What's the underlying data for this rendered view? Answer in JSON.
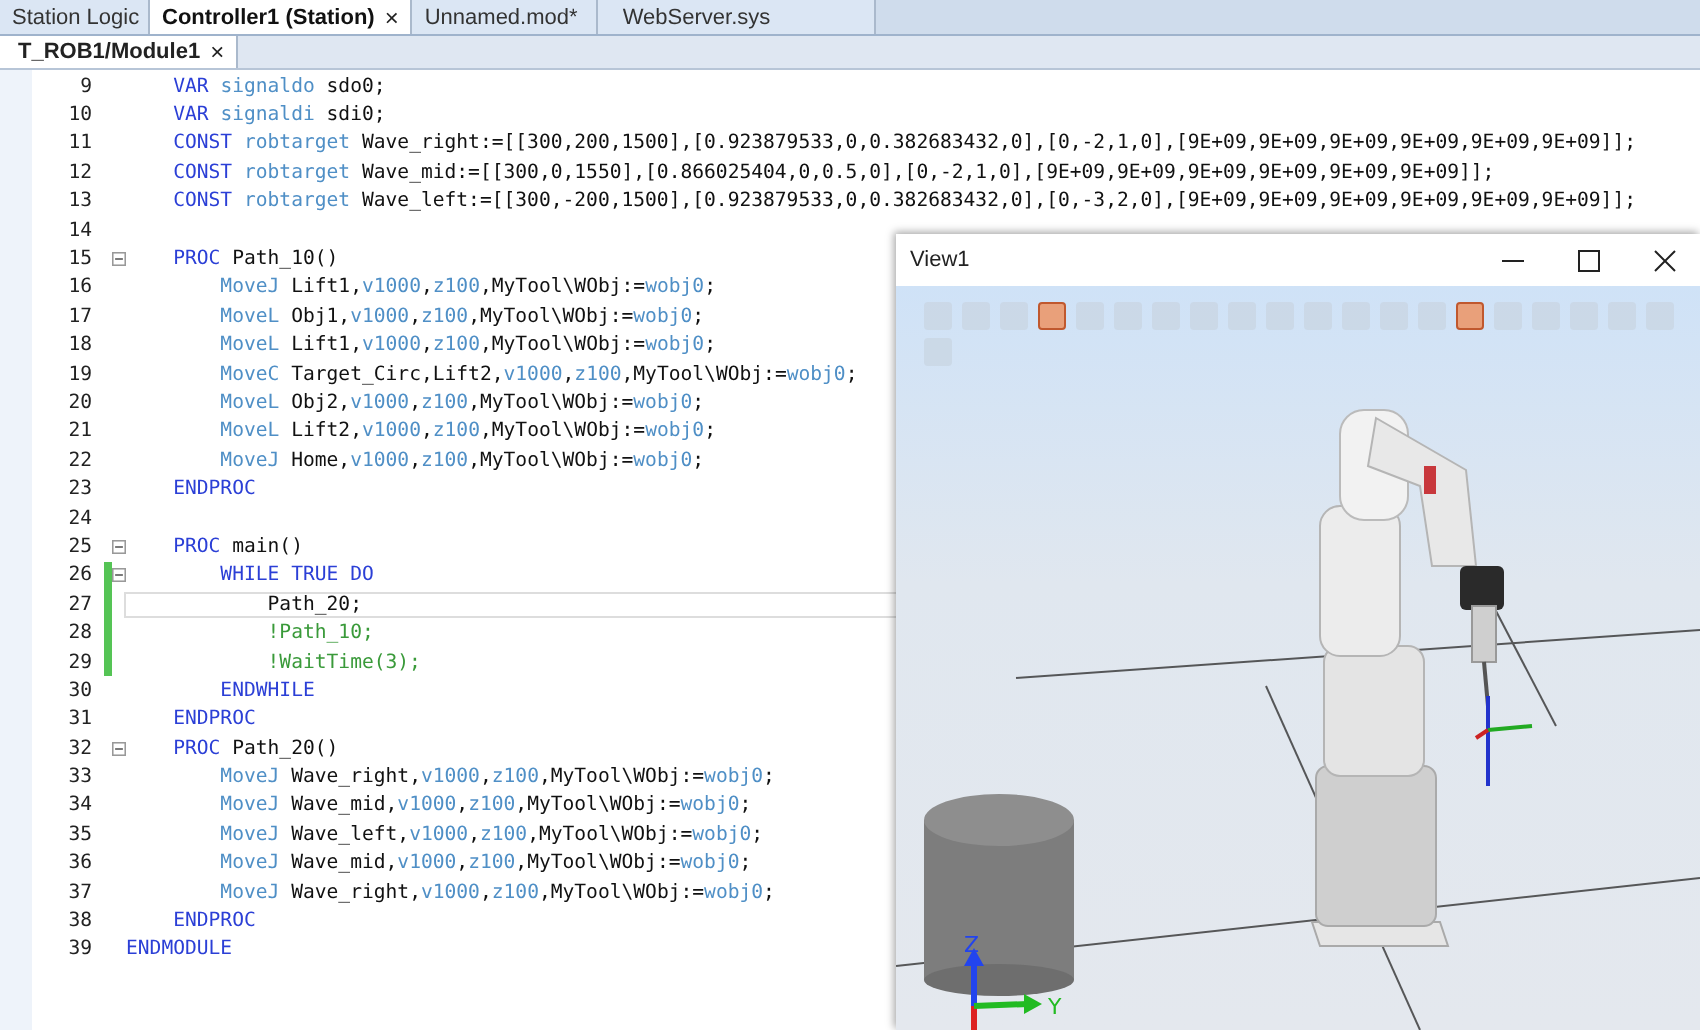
{
  "tabs": [
    {
      "label": "Station Logic",
      "selected": false
    },
    {
      "label": "Controller1 (Station)",
      "selected": true,
      "close": "×"
    },
    {
      "label": "Unnamed.mod*",
      "selected": false
    },
    {
      "label": "WebServer.sys",
      "selected": false
    }
  ],
  "subtabs": [
    {
      "label": "T_ROB1/Module1",
      "selected": true,
      "close": "×"
    }
  ],
  "code_lines": [
    {
      "number": "9",
      "fold": false,
      "modified": false,
      "current": false,
      "segments": [
        {
          "kind": "kw",
          "text": "    VAR"
        },
        {
          "kind": "type",
          "text": " signaldo"
        },
        {
          "kind": "plain",
          "text": " sdo0;"
        }
      ]
    },
    {
      "number": "10",
      "fold": false,
      "modified": false,
      "current": false,
      "segments": [
        {
          "kind": "kw",
          "text": "    VAR"
        },
        {
          "kind": "type",
          "text": " signaldi"
        },
        {
          "kind": "plain",
          "text": " sdi0;"
        }
      ]
    },
    {
      "number": "11",
      "fold": false,
      "modified": false,
      "current": false,
      "segments": [
        {
          "kind": "kw",
          "text": "    CONST"
        },
        {
          "kind": "type",
          "text": " robtarget"
        },
        {
          "kind": "plain",
          "text": " Wave_right:=[[300,200,1500],[0.923879533,0,0.382683432,0],[0,-2,1,0],[9E+09,9E+09,9E+09,9E+09,9E+09,9E+09]];"
        }
      ]
    },
    {
      "number": "12",
      "fold": false,
      "modified": false,
      "current": false,
      "segments": [
        {
          "kind": "kw",
          "text": "    CONST"
        },
        {
          "kind": "type",
          "text": " robtarget"
        },
        {
          "kind": "plain",
          "text": " Wave_mid:=[[300,0,1550],[0.866025404,0,0.5,0],[0,-2,1,0],[9E+09,9E+09,9E+09,9E+09,9E+09,9E+09]];"
        }
      ]
    },
    {
      "number": "13",
      "fold": false,
      "modified": false,
      "current": false,
      "segments": [
        {
          "kind": "kw",
          "text": "    CONST"
        },
        {
          "kind": "type",
          "text": " robtarget"
        },
        {
          "kind": "plain",
          "text": " Wave_left:=[[300,-200,1500],[0.923879533,0,0.382683432,0],[0,-3,2,0],[9E+09,9E+09,9E+09,9E+09,9E+09,9E+09]];"
        }
      ]
    },
    {
      "number": "14",
      "fold": false,
      "modified": false,
      "current": false
    },
    {
      "number": "15",
      "fold": true,
      "modified": false,
      "current": false,
      "segments": [
        {
          "kind": "kw",
          "text": "    PROC"
        },
        {
          "kind": "plain",
          "text": " Path_10()"
        }
      ]
    },
    {
      "number": "16",
      "fold": false,
      "modified": false,
      "current": false,
      "segments": [
        {
          "kind": "type",
          "text": "        MoveJ"
        },
        {
          "kind": "plain",
          "text": " Lift1,"
        },
        {
          "kind": "type",
          "text": "v1000"
        },
        {
          "kind": "plain",
          "text": ","
        },
        {
          "kind": "type",
          "text": "z100"
        },
        {
          "kind": "plain",
          "text": ",MyTool\\WObj:="
        },
        {
          "kind": "type",
          "text": "wobj0"
        },
        {
          "kind": "plain",
          "text": ";"
        }
      ]
    },
    {
      "number": "17",
      "fold": false,
      "modified": false,
      "current": false,
      "segments": [
        {
          "kind": "type",
          "text": "        MoveL"
        },
        {
          "kind": "plain",
          "text": " Obj1,"
        },
        {
          "kind": "type",
          "text": "v1000"
        },
        {
          "kind": "plain",
          "text": ","
        },
        {
          "kind": "type",
          "text": "z100"
        },
        {
          "kind": "plain",
          "text": ",MyTool\\WObj:="
        },
        {
          "kind": "type",
          "text": "wobj0"
        },
        {
          "kind": "plain",
          "text": ";"
        }
      ]
    },
    {
      "number": "18",
      "fold": false,
      "modified": false,
      "current": false,
      "segments": [
        {
          "kind": "type",
          "text": "        MoveL"
        },
        {
          "kind": "plain",
          "text": " Lift1,"
        },
        {
          "kind": "type",
          "text": "v1000"
        },
        {
          "kind": "plain",
          "text": ","
        },
        {
          "kind": "type",
          "text": "z100"
        },
        {
          "kind": "plain",
          "text": ",MyTool\\WObj:="
        },
        {
          "kind": "type",
          "text": "wobj0"
        },
        {
          "kind": "plain",
          "text": ";"
        }
      ]
    },
    {
      "number": "19",
      "fold": false,
      "modified": false,
      "current": false,
      "segments": [
        {
          "kind": "type",
          "text": "        MoveC"
        },
        {
          "kind": "plain",
          "text": " Target_Circ,Lift2,"
        },
        {
          "kind": "type",
          "text": "v1000"
        },
        {
          "kind": "plain",
          "text": ","
        },
        {
          "kind": "type",
          "text": "z100"
        },
        {
          "kind": "plain",
          "text": ",MyTool\\WObj:="
        },
        {
          "kind": "type",
          "text": "wobj0"
        },
        {
          "kind": "plain",
          "text": ";"
        }
      ]
    },
    {
      "number": "20",
      "fold": false,
      "modified": false,
      "current": false,
      "segments": [
        {
          "kind": "type",
          "text": "        MoveL"
        },
        {
          "kind": "plain",
          "text": " Obj2,"
        },
        {
          "kind": "type",
          "text": "v1000"
        },
        {
          "kind": "plain",
          "text": ","
        },
        {
          "kind": "type",
          "text": "z100"
        },
        {
          "kind": "plain",
          "text": ",MyTool\\WObj:="
        },
        {
          "kind": "type",
          "text": "wobj0"
        },
        {
          "kind": "plain",
          "text": ";"
        }
      ]
    },
    {
      "number": "21",
      "fold": false,
      "modified": false,
      "current": false,
      "segments": [
        {
          "kind": "type",
          "text": "        MoveL"
        },
        {
          "kind": "plain",
          "text": " Lift2,"
        },
        {
          "kind": "type",
          "text": "v1000"
        },
        {
          "kind": "plain",
          "text": ","
        },
        {
          "kind": "type",
          "text": "z100"
        },
        {
          "kind": "plain",
          "text": ",MyTool\\WObj:="
        },
        {
          "kind": "type",
          "text": "wobj0"
        },
        {
          "kind": "plain",
          "text": ";"
        }
      ]
    },
    {
      "number": "22",
      "fold": false,
      "modified": false,
      "current": false,
      "segments": [
        {
          "kind": "type",
          "text": "        MoveJ"
        },
        {
          "kind": "plain",
          "text": " Home,"
        },
        {
          "kind": "type",
          "text": "v1000"
        },
        {
          "kind": "plain",
          "text": ","
        },
        {
          "kind": "type",
          "text": "z100"
        },
        {
          "kind": "plain",
          "text": ",MyTool\\WObj:="
        },
        {
          "kind": "type",
          "text": "wobj0"
        },
        {
          "kind": "plain",
          "text": ";"
        }
      ]
    },
    {
      "number": "23",
      "fold": false,
      "modified": false,
      "current": false,
      "segments": [
        {
          "kind": "kw",
          "text": "    ENDPROC"
        }
      ]
    },
    {
      "number": "24",
      "fold": false,
      "modified": false,
      "current": false
    },
    {
      "number": "25",
      "fold": true,
      "modified": false,
      "current": false,
      "segments": [
        {
          "kind": "kw",
          "text": "    PROC"
        },
        {
          "kind": "plain",
          "text": " main()"
        }
      ]
    },
    {
      "number": "26",
      "fold": true,
      "modified": true,
      "current": false,
      "segments": [
        {
          "kind": "kw",
          "text": "        WHILE TRUE DO"
        }
      ]
    },
    {
      "number": "27",
      "fold": false,
      "modified": true,
      "current": true,
      "segments": [
        {
          "kind": "plain",
          "text": "            Path_20;"
        }
      ]
    },
    {
      "number": "28",
      "fold": false,
      "modified": true,
      "current": false,
      "segments": [
        {
          "kind": "comment",
          "text": "            !Path_10;"
        }
      ]
    },
    {
      "number": "29",
      "fold": false,
      "modified": true,
      "current": false,
      "segments": [
        {
          "kind": "comment",
          "text": "            !WaitTime(3);"
        }
      ]
    },
    {
      "number": "30",
      "fold": false,
      "modified": false,
      "current": false,
      "segments": [
        {
          "kind": "kw",
          "text": "        ENDWHILE"
        }
      ]
    },
    {
      "number": "31",
      "fold": false,
      "modified": false,
      "current": false,
      "segments": [
        {
          "kind": "kw",
          "text": "    ENDPROC"
        }
      ]
    },
    {
      "number": "32",
      "fold": true,
      "modified": false,
      "current": false,
      "segments": [
        {
          "kind": "kw",
          "text": "    PROC"
        },
        {
          "kind": "plain",
          "text": " Path_20()"
        }
      ]
    },
    {
      "number": "33",
      "fold": false,
      "modified": false,
      "current": false,
      "segments": [
        {
          "kind": "type",
          "text": "        MoveJ"
        },
        {
          "kind": "plain",
          "text": " Wave_right,"
        },
        {
          "kind": "type",
          "text": "v1000"
        },
        {
          "kind": "plain",
          "text": ","
        },
        {
          "kind": "type",
          "text": "z100"
        },
        {
          "kind": "plain",
          "text": ",MyTool\\WObj:="
        },
        {
          "kind": "type",
          "text": "wobj0"
        },
        {
          "kind": "plain",
          "text": ";"
        }
      ]
    },
    {
      "number": "34",
      "fold": false,
      "modified": false,
      "current": false,
      "segments": [
        {
          "kind": "type",
          "text": "        MoveJ"
        },
        {
          "kind": "plain",
          "text": " Wave_mid,"
        },
        {
          "kind": "type",
          "text": "v1000"
        },
        {
          "kind": "plain",
          "text": ","
        },
        {
          "kind": "type",
          "text": "z100"
        },
        {
          "kind": "plain",
          "text": ",MyTool\\WObj:="
        },
        {
          "kind": "type",
          "text": "wobj0"
        },
        {
          "kind": "plain",
          "text": ";"
        }
      ]
    },
    {
      "number": "35",
      "fold": false,
      "modified": false,
      "current": false,
      "segments": [
        {
          "kind": "type",
          "text": "        MoveJ"
        },
        {
          "kind": "plain",
          "text": " Wave_left,"
        },
        {
          "kind": "type",
          "text": "v1000"
        },
        {
          "kind": "plain",
          "text": ","
        },
        {
          "kind": "type",
          "text": "z100"
        },
        {
          "kind": "plain",
          "text": ",MyTool\\WObj:="
        },
        {
          "kind": "type",
          "text": "wobj0"
        },
        {
          "kind": "plain",
          "text": ";"
        }
      ]
    },
    {
      "number": "36",
      "fold": false,
      "modified": false,
      "current": false,
      "segments": [
        {
          "kind": "type",
          "text": "        MoveJ"
        },
        {
          "kind": "plain",
          "text": " Wave_mid,"
        },
        {
          "kind": "type",
          "text": "v1000"
        },
        {
          "kind": "plain",
          "text": ","
        },
        {
          "kind": "type",
          "text": "z100"
        },
        {
          "kind": "plain",
          "text": ",MyTool\\WObj:="
        },
        {
          "kind": "type",
          "text": "wobj0"
        },
        {
          "kind": "plain",
          "text": ";"
        }
      ]
    },
    {
      "number": "37",
      "fold": false,
      "modified": false,
      "current": false,
      "segments": [
        {
          "kind": "type",
          "text": "        MoveJ"
        },
        {
          "kind": "plain",
          "text": " Wave_right,"
        },
        {
          "kind": "type",
          "text": "v1000"
        },
        {
          "kind": "plain",
          "text": ","
        },
        {
          "kind": "type",
          "text": "z100"
        },
        {
          "kind": "plain",
          "text": ",MyTool\\WObj:="
        },
        {
          "kind": "type",
          "text": "wobj0"
        },
        {
          "kind": "plain",
          "text": ";"
        }
      ]
    },
    {
      "number": "38",
      "fold": false,
      "modified": false,
      "current": false,
      "segments": [
        {
          "kind": "kw",
          "text": "    ENDPROC"
        }
      ]
    },
    {
      "number": "39",
      "fold": false,
      "modified": false,
      "current": false,
      "segments": [
        {
          "kind": "kw",
          "text": "ENDMODULE"
        }
      ]
    }
  ],
  "view_window": {
    "title": "View1",
    "toolbar": [
      {
        "selected": false
      },
      {
        "selected": false
      },
      {
        "selected": false
      },
      {
        "selected": true
      },
      {
        "selected": false
      },
      {
        "selected": false
      },
      {
        "selected": false
      },
      {
        "selected": false
      },
      {
        "selected": false
      },
      {
        "selected": false
      },
      {
        "selected": false
      },
      {
        "selected": false
      },
      {
        "selected": false
      },
      {
        "selected": false
      },
      {
        "selected": true
      },
      {
        "selected": false
      },
      {
        "selected": false
      },
      {
        "selected": false
      },
      {
        "selected": false
      },
      {
        "selected": false
      },
      {
        "selected": false
      }
    ],
    "axes": {
      "z": "Z",
      "y": "Y"
    }
  }
}
